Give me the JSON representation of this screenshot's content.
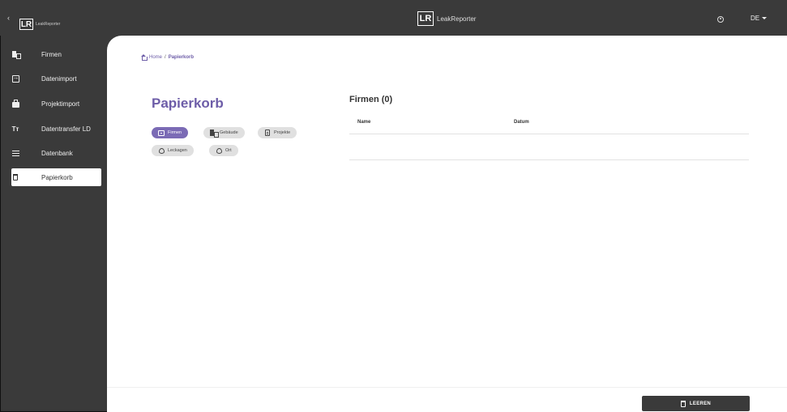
{
  "app": {
    "logo_mark": "LR",
    "name_small": "LeakReporter",
    "name": "LeakReporter",
    "collapse_glyph": "‹",
    "language": "DE"
  },
  "sidebar": {
    "items": [
      {
        "label": "Firmen",
        "icon": "building-icon"
      },
      {
        "label": "Datenimport",
        "icon": "import-icon"
      },
      {
        "label": "Projektimport",
        "icon": "briefcase-icon"
      },
      {
        "label": "Datentransfer LD",
        "icon": "text-transfer-icon",
        "glyph": "Tт"
      },
      {
        "label": "Datenbank",
        "icon": "database-icon"
      },
      {
        "label": "Papierkorb",
        "icon": "trash-icon",
        "active": true
      }
    ]
  },
  "breadcrumb": {
    "home": "Home",
    "separator": "/",
    "current": "Papierkorb"
  },
  "page": {
    "title": "Papierkorb"
  },
  "filters": [
    {
      "label": "Firmen",
      "icon": "company-icon",
      "active": true
    },
    {
      "label": "Gebäude",
      "icon": "building-icon",
      "active": false
    },
    {
      "label": "Projekte",
      "icon": "project-icon",
      "active": false
    },
    {
      "label": "Leckagen",
      "icon": "leak-icon",
      "active": false
    },
    {
      "label": "Ort",
      "icon": "location-icon",
      "active": false
    }
  ],
  "list": {
    "title": "Firmen (0)",
    "columns": [
      "Name",
      "Datum"
    ],
    "rows": []
  },
  "footer": {
    "empty_button": "LEEREN"
  },
  "colors": {
    "accent": "#7b6bb5",
    "sidebar_bg": "#3a3a3a",
    "content_bg": "#ffffff"
  }
}
